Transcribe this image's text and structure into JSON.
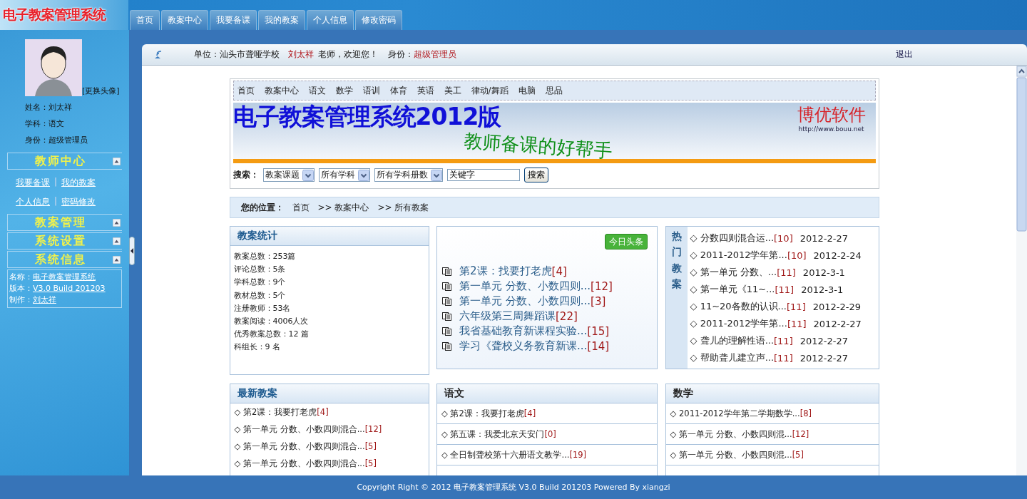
{
  "header": {
    "logo": "电子教案管理系统",
    "tabs": [
      {
        "label": "首页"
      },
      {
        "label": "教案中心"
      },
      {
        "label": "我要备课"
      },
      {
        "label": "我的教案"
      },
      {
        "label": "个人信息"
      },
      {
        "label": "修改密码"
      }
    ]
  },
  "sidebar": {
    "change_avatar": "[更换头像]",
    "profile": [
      {
        "label": "姓名：",
        "value": "刘太祥"
      },
      {
        "label": "学科：",
        "value": "语文"
      },
      {
        "label": "身份：",
        "value": "超级管理员"
      }
    ],
    "sections": [
      {
        "title": "教师中心",
        "links": [
          [
            "我要备课",
            "我的教案"
          ],
          [
            "个人信息",
            "密码修改"
          ]
        ],
        "separator": "|"
      },
      {
        "title": "教案管理"
      },
      {
        "title": "系统设置"
      },
      {
        "title": "系统信息",
        "info": [
          {
            "label": "名称：",
            "value": "电子教案管理系统"
          },
          {
            "label": "版本：",
            "value": "V3.0 Build 201203"
          },
          {
            "label": "制作：",
            "value": "刘太祥"
          }
        ]
      }
    ]
  },
  "user_bar": {
    "unit_label": "单位：",
    "unit": "汕头市聋哑学校",
    "name": "刘太祥",
    "greeting": "老师，欢迎您！",
    "role_label": "身份：",
    "role": "超级管理员",
    "logout": "退出"
  },
  "nav": [
    "首页",
    "教案中心",
    "语文",
    "数学",
    "语训",
    "体育",
    "英语",
    "美工",
    "律动/舞蹈",
    "电脑",
    "思品"
  ],
  "banner": {
    "title": "电子教案管理系统2012版",
    "slogan": "教师备课的好帮手",
    "brand": "博优软件",
    "url": "http://www.bouu.net"
  },
  "search": {
    "label": "搜索：",
    "selects": [
      "教案课题",
      "所有学科",
      "所有学科册数"
    ],
    "keyword": "关键字",
    "button": "搜索"
  },
  "breadcrumb": {
    "label": "您的位置：",
    "items": [
      "首页",
      ">> 教案中心",
      ">> 所有教案"
    ]
  },
  "stats": {
    "title": "教案统计",
    "lines": [
      "教案总数：253篇",
      "评论总数：5条",
      "学科总数：9个",
      "教材总数：5个",
      "注册教师：53名",
      "教案阅读：4006人次",
      "优秀教案总数：12 篇",
      "科组长：9 名"
    ]
  },
  "headlines": {
    "badge": "今日头条",
    "items": [
      {
        "title": "第2课：找要打老虎",
        "count": "[4]"
      },
      {
        "title": "第一单元 分数、小数四则...",
        "count": "[12]"
      },
      {
        "title": "第一单元 分数、小数四则...",
        "count": "[3]"
      },
      {
        "title": "六年级第三周舞蹈课",
        "count": "[22]"
      },
      {
        "title": "我省基础教育新课程实验...",
        "count": "[15]"
      },
      {
        "title": "学习《聋校义务教育新课...",
        "count": "[14]"
      }
    ]
  },
  "hot": {
    "title": "热门教案",
    "items": [
      {
        "title": "◇ 分数四则混合运...",
        "count": "[10]",
        "date": "2012-2-27"
      },
      {
        "title": "◇ 2011-2012学年第...",
        "count": "[10]",
        "date": "2012-2-24"
      },
      {
        "title": "◇ 第一单元 分数、...",
        "count": "[11]",
        "date": "2012-3-1"
      },
      {
        "title": "◇ 第一单元《11~...",
        "count": "[11]",
        "date": "2012-3-1"
      },
      {
        "title": "◇ 11~20各数的认识...",
        "count": "[11]",
        "date": "2012-2-29"
      },
      {
        "title": "◇ 2011-2012学年第...",
        "count": "[11]",
        "date": "2012-2-27"
      },
      {
        "title": "◇ 聋儿的理解性语...",
        "count": "[11]",
        "date": "2012-2-27"
      },
      {
        "title": "◇ 帮助聋儿建立声...",
        "count": "[11]",
        "date": "2012-2-27"
      }
    ]
  },
  "lists": [
    {
      "title": "最新教案",
      "kind": "plain",
      "items": [
        {
          "title": "◇ 第2课：我要打老虎",
          "count": "[4]"
        },
        {
          "title": "◇ 第一单元 分数、小数四则混合...",
          "count": "[12]"
        },
        {
          "title": "◇ 第一单元 分数、小数四则混合...",
          "count": "[5]"
        },
        {
          "title": "◇ 第一单元 分数、小数四则混合...",
          "count": "[5]"
        }
      ]
    },
    {
      "title": "语文",
      "kind": "ruled",
      "items": [
        {
          "title": "◇ 第2课：我要打老虎",
          "count": "[4]"
        },
        {
          "title": "◇ 第五课：我爱北京天安门",
          "count": "[0]"
        },
        {
          "title": "◇ 全日制聋校第十六册语文教学...",
          "count": "[19]"
        }
      ]
    },
    {
      "title": "数学",
      "kind": "ruled",
      "items": [
        {
          "title": "◇ 2011-2012学年第二学期数学...",
          "count": "[8]"
        },
        {
          "title": "◇ 第一单元 分数、小数四则混...",
          "count": "[12]"
        },
        {
          "title": "◇ 第一单元 分数、小数四则混...",
          "count": "[5]"
        }
      ]
    }
  ],
  "footer": "Copyright Right © 2012  电子教案管理系统 V3.0 Build 201203  Powered By xiangzi"
}
